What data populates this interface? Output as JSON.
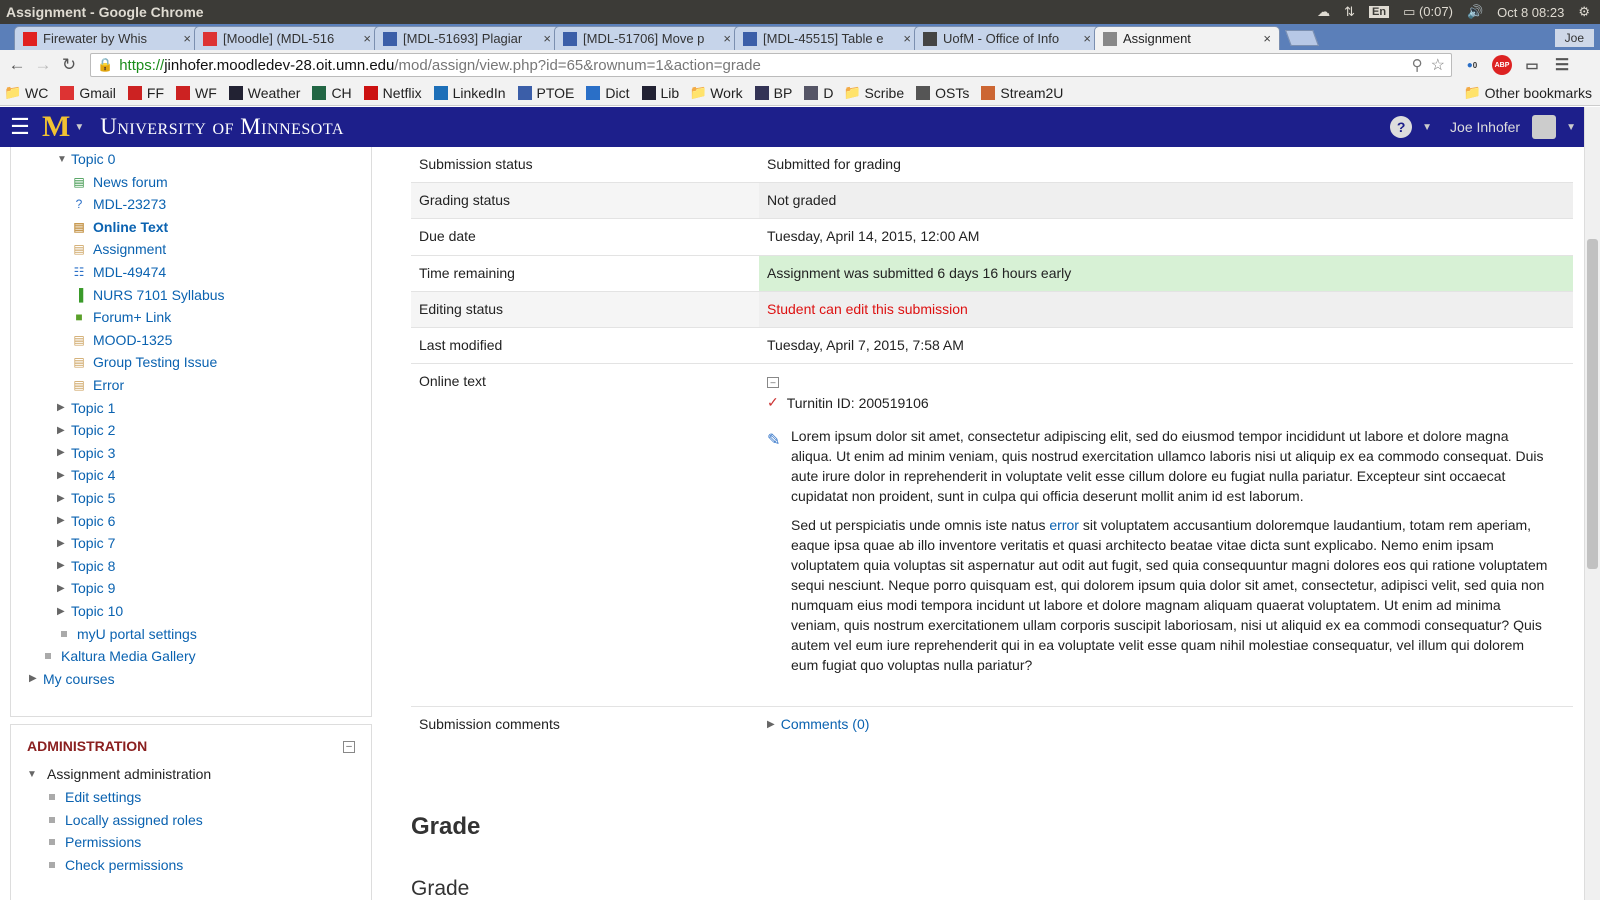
{
  "os": {
    "window_title": "Assignment - Google Chrome",
    "lang": "En",
    "battery": "(0:07)",
    "clock": "Oct  8 08:23"
  },
  "tabs": [
    {
      "label": "Firewater by Whis",
      "icon": "youtube-icon",
      "color": "#e02020",
      "active": false
    },
    {
      "label": "[Moodle] (MDL-516",
      "icon": "gmail-icon",
      "color": "#d33",
      "active": false
    },
    {
      "label": "[MDL-51693] Plagiar",
      "icon": "jira-icon",
      "color": "#3b5ea8",
      "active": false
    },
    {
      "label": "[MDL-51706] Move p",
      "icon": "jira-icon",
      "color": "#3b5ea8",
      "active": false
    },
    {
      "label": "[MDL-45515] Table e",
      "icon": "jira-icon",
      "color": "#3b5ea8",
      "active": false
    },
    {
      "label": "UofM - Office of Info",
      "icon": "chat-icon",
      "color": "#444",
      "active": false
    },
    {
      "label": "Assignment",
      "icon": "page-icon",
      "color": "#888",
      "active": true
    }
  ],
  "profile_name": "Joe",
  "url": {
    "scheme": "https://",
    "host": "jinhofer.moodledev-28.oit.umn.edu",
    "path": "/mod/assign/view.php?id=65&rownum=1&action=grade"
  },
  "extensions": {
    "abp": "ABP",
    "badge": "0"
  },
  "bookmarks": [
    {
      "label": "WC",
      "icon": "folder-icon",
      "color": "#a08040"
    },
    {
      "label": "Gmail",
      "icon": "gmail-icon",
      "color": "#d33"
    },
    {
      "label": "FF",
      "icon": "nfl-icon",
      "color": "#c22"
    },
    {
      "label": "WF",
      "icon": "wf-icon",
      "color": "#c22"
    },
    {
      "label": "Weather",
      "icon": "weather-icon",
      "color": "#223"
    },
    {
      "label": "CH",
      "icon": "ch-icon",
      "color": "#264"
    },
    {
      "label": "Netflix",
      "icon": "netflix-icon",
      "color": "#c11"
    },
    {
      "label": "LinkedIn",
      "icon": "linkedin-icon",
      "color": "#1d6fb8"
    },
    {
      "label": "PTOE",
      "icon": "ptoe-icon",
      "color": "#3b5ea8"
    },
    {
      "label": "Dict",
      "icon": "dict-icon",
      "color": "#2a6fc7"
    },
    {
      "label": "Lib",
      "icon": "lib-icon",
      "color": "#223"
    },
    {
      "label": "Work",
      "icon": "folder-icon",
      "color": "#a08040"
    },
    {
      "label": "BP",
      "icon": "bp-icon",
      "color": "#335"
    },
    {
      "label": "D",
      "icon": "d-icon",
      "color": "#556"
    },
    {
      "label": "Scribe",
      "icon": "folder-icon",
      "color": "#a08040"
    },
    {
      "label": "OSTs",
      "icon": "osts-icon",
      "color": "#555"
    },
    {
      "label": "Stream2U",
      "icon": "stream-icon",
      "color": "#c63"
    }
  ],
  "other_bookmarks": "Other bookmarks",
  "header": {
    "logo": "M",
    "university": "University of Minnesota",
    "user_name": "Joe Inhofer",
    "help": "?"
  },
  "nav": {
    "topic0": "Topic 0",
    "activities": [
      {
        "label": "News forum",
        "icon": "forum-icon",
        "bold": false
      },
      {
        "label": "MDL-23273",
        "icon": "question-icon",
        "bold": false
      },
      {
        "label": "Online Text",
        "icon": "assign-icon",
        "bold": true
      },
      {
        "label": "Assignment",
        "icon": "assign-icon",
        "bold": false
      },
      {
        "label": "MDL-49474",
        "icon": "database-icon",
        "bold": false
      },
      {
        "label": "NURS 7101 Syllabus",
        "icon": "book-icon",
        "bold": false
      },
      {
        "label": "Forum+ Link",
        "icon": "forum-plus-icon",
        "bold": false
      },
      {
        "label": "MOOD-1325",
        "icon": "assign-icon",
        "bold": false
      },
      {
        "label": "Group Testing Issue",
        "icon": "assign-icon",
        "bold": false
      },
      {
        "label": "Error",
        "icon": "assign-icon",
        "bold": false
      }
    ],
    "topics": [
      "Topic 1",
      "Topic 2",
      "Topic 3",
      "Topic 4",
      "Topic 5",
      "Topic 6",
      "Topic 7",
      "Topic 8",
      "Topic 9",
      "Topic 10"
    ],
    "myu": "myU portal settings",
    "kaltura": "Kaltura Media Gallery",
    "my_courses": "My courses"
  },
  "admin": {
    "title": "ADMINISTRATION",
    "section": "Assignment administration",
    "items": [
      "Edit settings",
      "Locally assigned roles",
      "Permissions",
      "Check permissions"
    ]
  },
  "submission": {
    "rows": [
      {
        "label": "Submission status",
        "value": "Submitted for grading",
        "style": "plain"
      },
      {
        "label": "Grading status",
        "value": "Not graded",
        "style": "alt"
      },
      {
        "label": "Due date",
        "value": "Tuesday, April 14, 2015, 12:00 AM",
        "style": "plain"
      },
      {
        "label": "Time remaining",
        "value": "Assignment was submitted 6 days 16 hours early",
        "style": "ok"
      },
      {
        "label": "Editing status",
        "value": "Student can edit this submission",
        "style": "alt-red"
      },
      {
        "label": "Last modified",
        "value": "Tuesday, April 7, 2015, 7:58 AM",
        "style": "plain"
      }
    ],
    "online_text_label": "Online text",
    "turnitin": "Turnitin ID: 200519106",
    "para1": "Lorem ipsum dolor sit amet, consectetur adipiscing elit, sed do eiusmod tempor incididunt ut labore et dolore magna aliqua. Ut enim ad minim veniam, quis nostrud exercitation ullamco laboris nisi ut aliquip ex ea commodo consequat. Duis aute irure dolor in reprehenderit in voluptate velit esse cillum dolore eu fugiat nulla pariatur. Excepteur sint occaecat cupidatat non proident, sunt in culpa qui officia deserunt mollit anim id est laborum.",
    "para2_before": "Sed ut perspiciatis unde omnis iste natus ",
    "para2_link": "error",
    "para2_after": " sit voluptatem accusantium doloremque laudantium, totam rem aperiam, eaque ipsa quae ab illo inventore veritatis et quasi architecto beatae vitae dicta sunt explicabo. Nemo enim ipsam voluptatem quia voluptas sit aspernatur aut odit aut fugit, sed quia consequuntur magni dolores eos qui ratione voluptatem sequi nesciunt. Neque porro quisquam est, qui dolorem ipsum quia dolor sit amet, consectetur, adipisci velit, sed quia non numquam eius modi tempora incidunt ut labore et dolore magnam aliquam quaerat voluptatem. Ut enim ad minima veniam, quis nostrum exercitationem ullam corporis suscipit laboriosam, nisi ut aliquid ex ea commodi consequatur? Quis autem vel eum iure reprehenderit qui in ea voluptate velit esse quam nihil molestiae consequatur, vel illum qui dolorem eum fugiat quo voluptas nulla pariatur?",
    "comments_label": "Submission comments",
    "comments_link": "Comments (0)"
  },
  "grade": {
    "heading": "Grade",
    "subheading": "Grade"
  }
}
